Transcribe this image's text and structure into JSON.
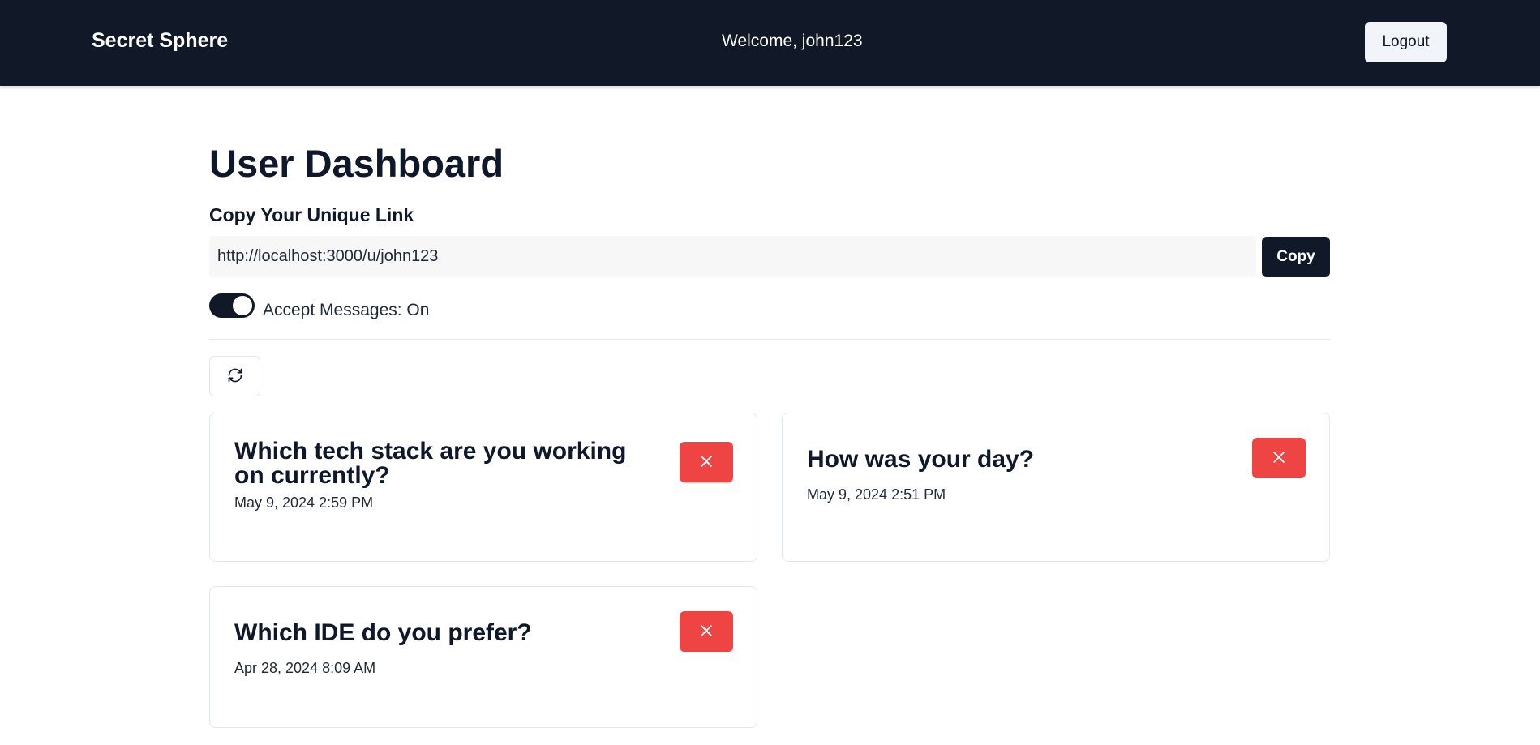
{
  "navbar": {
    "brand": "Secret Sphere",
    "welcome": "Welcome, john123",
    "logout_label": "Logout"
  },
  "dashboard": {
    "title": "User Dashboard",
    "link_section_label": "Copy Your Unique Link",
    "unique_link": "http://localhost:3000/u/john123",
    "copy_label": "Copy",
    "accept_messages_label": "Accept Messages: On",
    "accept_messages_on": true
  },
  "messages": [
    {
      "text": "Which tech stack are you working on currently?",
      "date": "May 9, 2024 2:59 PM"
    },
    {
      "text": "How was your day?",
      "date": "May 9, 2024 2:51 PM"
    },
    {
      "text": "Which IDE do you prefer?",
      "date": "Apr 28, 2024 8:09 AM"
    }
  ],
  "icons": {
    "refresh": "refresh-icon",
    "delete": "x-icon"
  },
  "colors": {
    "navbar_bg": "#111827",
    "primary": "#111827",
    "danger": "#ef4444"
  }
}
